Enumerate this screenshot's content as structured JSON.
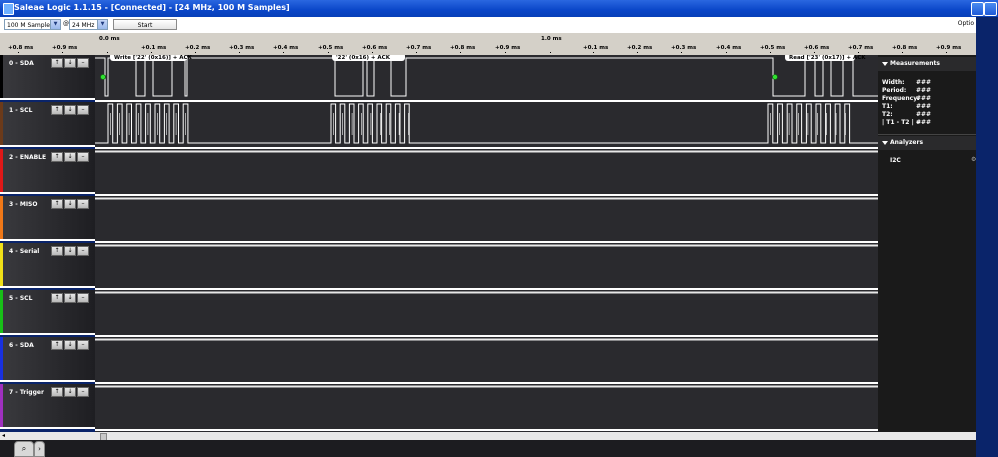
{
  "window": {
    "title": "Saleae Logic 1.1.15 - [Connected] - [24 MHz, 100 M Samples]"
  },
  "toolbar": {
    "samples": "100 M Samples",
    "at": "@",
    "rate": "24 MHz",
    "start_label": "Start",
    "options_label": "Optio"
  },
  "timebar": {
    "main_labels": [
      {
        "text": "0.0 ms"
      },
      {
        "text": "1.0 ms"
      }
    ],
    "ticks": [
      "+0.8 ms",
      "+0.9 ms",
      "+0.1 ms",
      "+0.2 ms",
      "+0.3 ms",
      "+0.4 ms",
      "+0.5 ms",
      "+0.6 ms",
      "+0.7 ms",
      "+0.8 ms",
      "+0.9 ms",
      "+0.1 ms",
      "+0.2 ms",
      "+0.3 ms",
      "+0.4 ms",
      "+0.5 ms",
      "+0.6 ms",
      "+0.7 ms",
      "+0.8 ms",
      "+0.9 ms"
    ]
  },
  "channels": [
    {
      "name": "0 - SDA",
      "color": "#000000"
    },
    {
      "name": "1 - SCL",
      "color": "#6b3a1a"
    },
    {
      "name": "2 - ENABLE",
      "color": "#e01818"
    },
    {
      "name": "3 - MISO",
      "color": "#f07818"
    },
    {
      "name": "4 - Serial",
      "color": "#f0e018"
    },
    {
      "name": "5 - SCL",
      "color": "#18c018"
    },
    {
      "name": "6 - SDA",
      "color": "#1830e0"
    },
    {
      "name": "7 - Trigger",
      "color": "#a030c0"
    }
  ],
  "channel_button_icons": [
    "rising-edge-icon",
    "falling-edge-icon",
    "minimize-icon"
  ],
  "annotations": [
    {
      "text": "Write ['22' (0x16)] + ACK"
    },
    {
      "text": "'22' (0x16) + ACK"
    },
    {
      "text": "Read ['23' (0x17)] + ACK"
    }
  ],
  "panel": {
    "measurements_title": "Measurements",
    "measurements": [
      {
        "label": "Width:",
        "value": "###"
      },
      {
        "label": "Period:",
        "value": "###"
      },
      {
        "label": "Frequency:",
        "value": "###"
      },
      {
        "label": "T1:",
        "value": "###"
      },
      {
        "label": "T2:",
        "value": "###"
      },
      {
        "label": "| T1 - T2 | =",
        "value": "###"
      }
    ],
    "analyzers_title": "Analyzers",
    "analyzers": [
      {
        "name": "I2C"
      }
    ]
  },
  "tabs": [
    {
      "icon": "search-icon"
    },
    {
      "icon": "chevron-right-icon"
    }
  ]
}
